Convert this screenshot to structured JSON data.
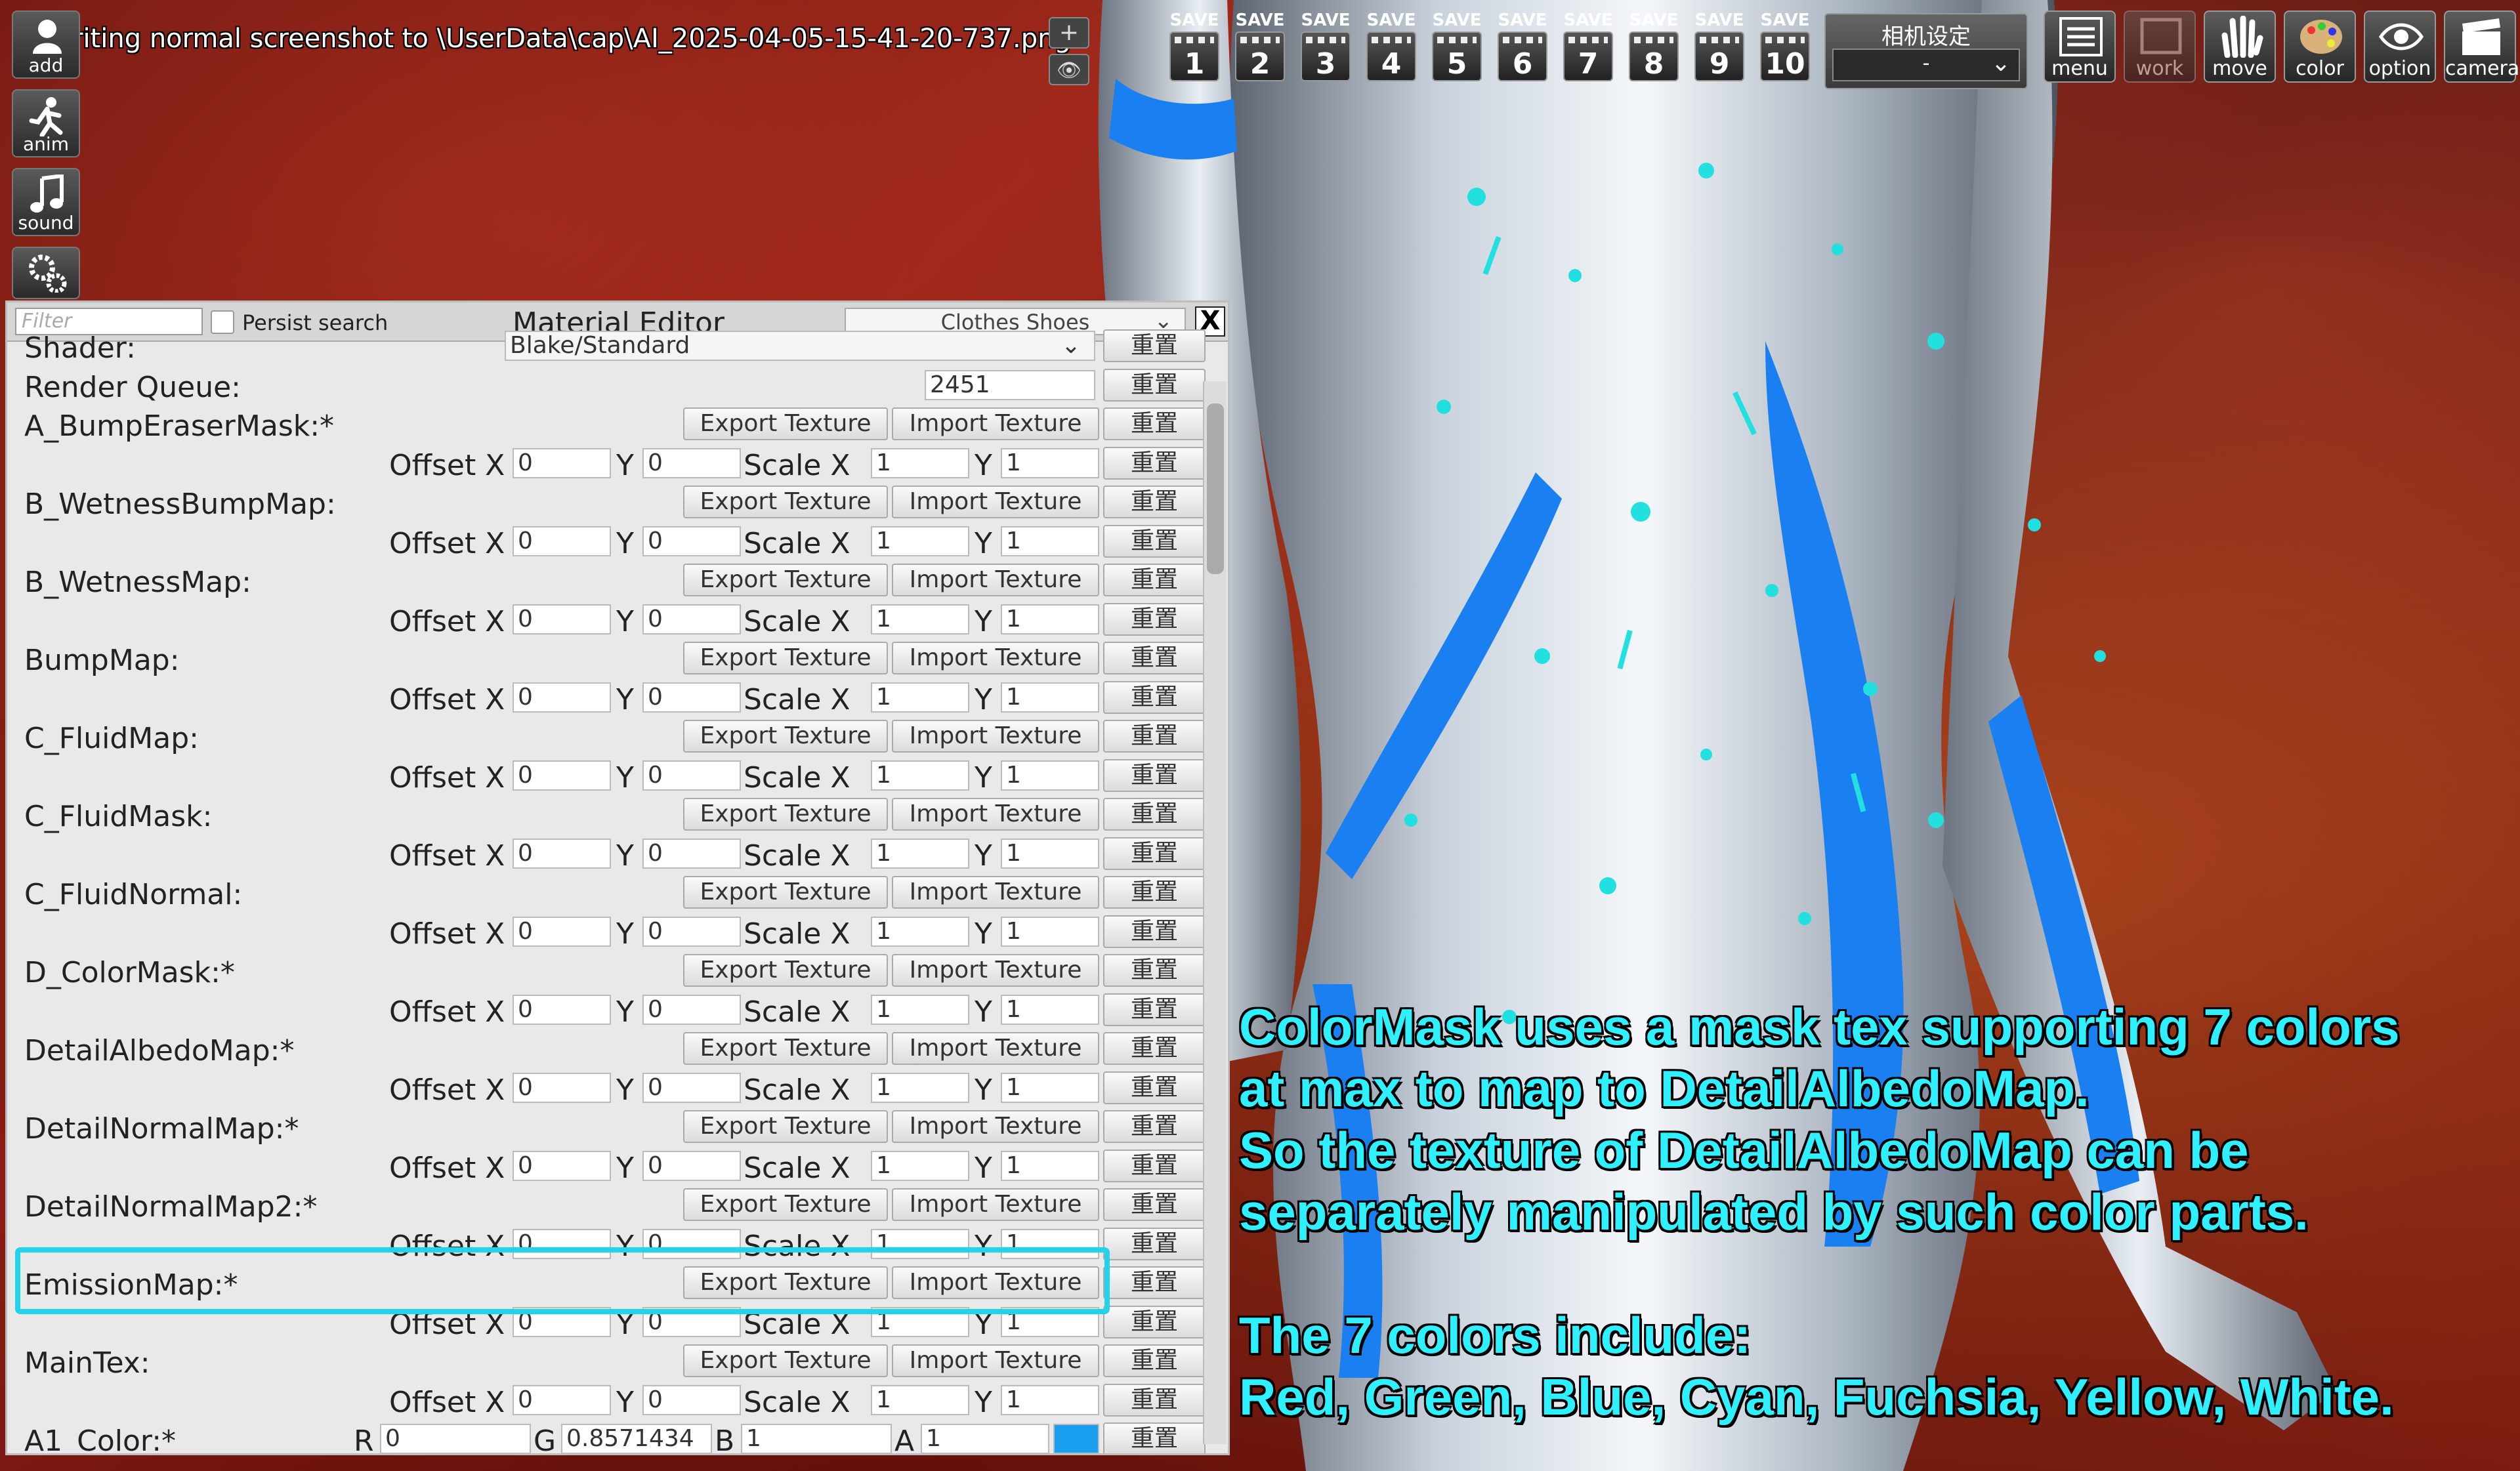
{
  "status": "riting normal screenshot to \\UserData\\cap\\AI_2025-04-05-15-41-20-737.png",
  "left_toolbar": [
    {
      "id": "add",
      "label": "add",
      "icon": "person-icon"
    },
    {
      "id": "anim",
      "label": "anim",
      "icon": "running-person-icon"
    },
    {
      "id": "sound",
      "label": "sound",
      "icon": "music-note-icon"
    },
    {
      "id": "system",
      "label": "system",
      "icon": "gears-icon"
    }
  ],
  "controls": {
    "zoom_in": "+",
    "eye": "👁"
  },
  "save_slots": [
    {
      "label": "SAVE",
      "num": "1"
    },
    {
      "label": "SAVE",
      "num": "2"
    },
    {
      "label": "SAVE",
      "num": "3"
    },
    {
      "label": "SAVE",
      "num": "4"
    },
    {
      "label": "SAVE",
      "num": "5"
    },
    {
      "label": "SAVE",
      "num": "6"
    },
    {
      "label": "SAVE",
      "num": "7"
    },
    {
      "label": "SAVE",
      "num": "8"
    },
    {
      "label": "SAVE",
      "num": "9"
    },
    {
      "label": "SAVE",
      "num": "10"
    }
  ],
  "camera": {
    "title": "相机设定",
    "value": "-"
  },
  "right_toolbar": [
    {
      "id": "menu",
      "label": "menu",
      "icon": "menu-list-icon"
    },
    {
      "id": "work",
      "label": "work",
      "icon": "work-icon"
    },
    {
      "id": "move",
      "label": "move",
      "icon": "hand-icon"
    },
    {
      "id": "color",
      "label": "color",
      "icon": "palette-icon"
    },
    {
      "id": "option",
      "label": "option",
      "icon": "eye-icon"
    },
    {
      "id": "camera",
      "label": "camera",
      "icon": "clapper-icon"
    }
  ],
  "editor": {
    "filter_placeholder": "Filter",
    "persist_label": "Persist search",
    "title": "Material Editor",
    "category": "Clothes Shoes",
    "close": "X",
    "export_label": "Export Texture",
    "import_label": "Import Texture",
    "reset_label": "重置",
    "offset_x_label": "Offset X",
    "y_label": "Y",
    "scale_x_label": "Scale X",
    "shader_label": "Shader:",
    "shader_value": "Blake/Standard",
    "render_queue_label": "Render Queue:",
    "render_queue_value": "2451",
    "textures": [
      {
        "name": "A_BumpEraserMask:*",
        "offset_x": "0",
        "offset_y": "0",
        "scale_x": "1",
        "scale_y": "1"
      },
      {
        "name": "B_WetnessBumpMap:",
        "offset_x": "0",
        "offset_y": "0",
        "scale_x": "1",
        "scale_y": "1"
      },
      {
        "name": "B_WetnessMap:",
        "offset_x": "0",
        "offset_y": "0",
        "scale_x": "1",
        "scale_y": "1"
      },
      {
        "name": "BumpMap:",
        "offset_x": "0",
        "offset_y": "0",
        "scale_x": "1",
        "scale_y": "1"
      },
      {
        "name": "C_FluidMap:",
        "offset_x": "0",
        "offset_y": "0",
        "scale_x": "1",
        "scale_y": "1"
      },
      {
        "name": "C_FluidMask:",
        "offset_x": "0",
        "offset_y": "0",
        "scale_x": "1",
        "scale_y": "1"
      },
      {
        "name": "C_FluidNormal:",
        "offset_x": "0",
        "offset_y": "0",
        "scale_x": "1",
        "scale_y": "1"
      },
      {
        "name": "D_ColorMask:*",
        "offset_x": "0",
        "offset_y": "0",
        "scale_x": "1",
        "scale_y": "1"
      },
      {
        "name": "DetailAlbedoMap:*",
        "offset_x": "0",
        "offset_y": "0",
        "scale_x": "1",
        "scale_y": "1"
      },
      {
        "name": "DetailNormalMap:*",
        "offset_x": "0",
        "offset_y": "0",
        "scale_x": "1",
        "scale_y": "1"
      },
      {
        "name": "DetailNormalMap2:*",
        "offset_x": "0",
        "offset_y": "0",
        "scale_x": "1",
        "scale_y": "1"
      },
      {
        "name": "EmissionMap:*",
        "offset_x": "0",
        "offset_y": "0",
        "scale_x": "1",
        "scale_y": "1"
      },
      {
        "name": "MainTex:",
        "offset_x": "0",
        "offset_y": "0",
        "scale_x": "1",
        "scale_y": "1"
      }
    ],
    "last_row": {
      "name": "A1_Color:*",
      "r_label": "R",
      "r_value": "0",
      "g_label": "G",
      "g_value": "0.8571434",
      "b_label": "B",
      "b_value": "1",
      "a_label": "A",
      "a_value": "1",
      "swatch": "#1a9ef0"
    }
  },
  "caption": [
    "ColorMask uses a mask tex supporting 7 colors",
    "at max to map to DetailAlbedoMap.",
    "So the texture of DetailAlbedoMap can be",
    "separately manipulated by such color parts.",
    "",
    "The 7 colors include:",
    "Red, Green, Blue, Cyan, Fuchsia, Yellow, White."
  ],
  "colors": {
    "highlight": "#22d3ee",
    "caption": "#2ff0ff",
    "suit_blue": "#1a7ff0",
    "splash": "#22e0e0"
  }
}
